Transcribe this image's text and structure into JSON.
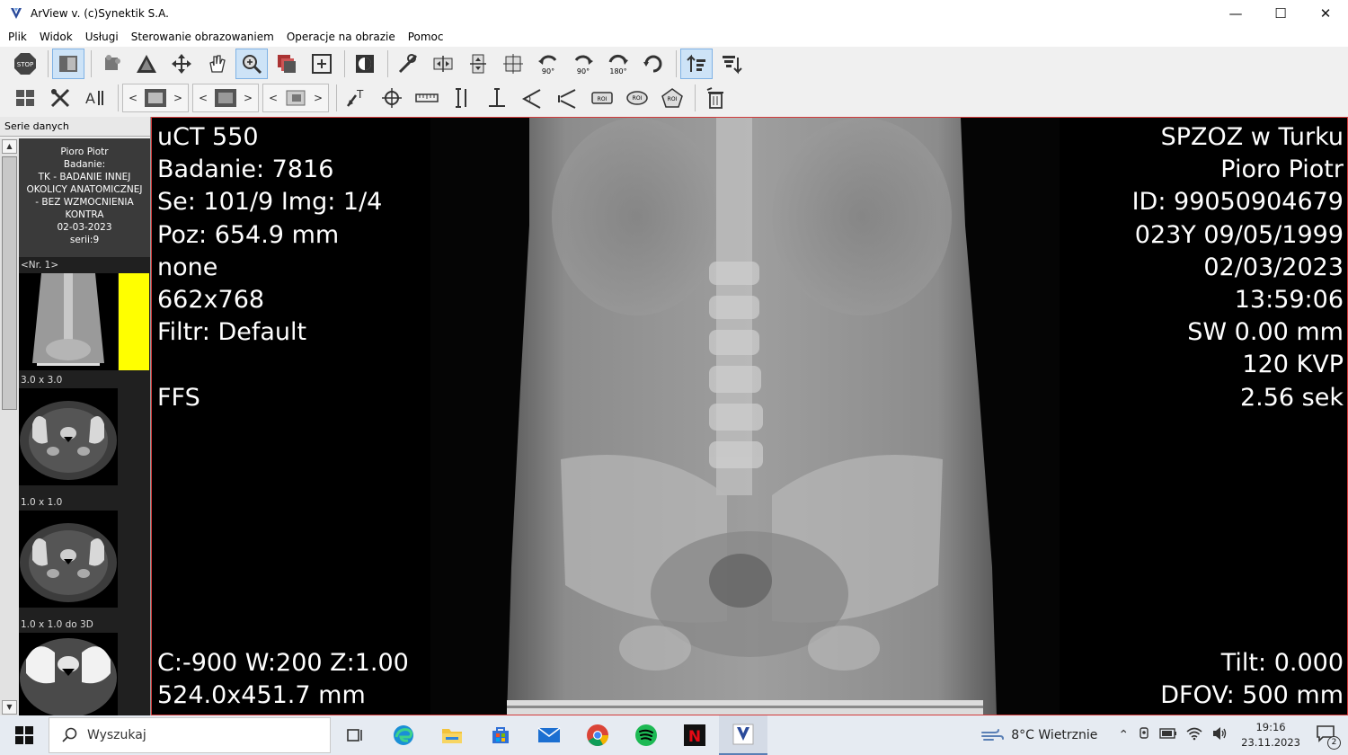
{
  "window": {
    "title": "ArView v. (c)Synektik S.A.",
    "icon": "arview-logo-icon",
    "controls": {
      "minimize": "—",
      "maximize": "☐",
      "close": "✕"
    }
  },
  "menu": [
    "Plik",
    "Widok",
    "Usługi",
    "Sterowanie obrazowaniem",
    "Operacje na obrazie",
    "Pomoc"
  ],
  "toolbar_row1": [
    {
      "name": "stop-icon",
      "label": "STOP"
    },
    {
      "name": "layout-panel-icon",
      "active": true
    },
    {
      "name": "puzzle-icon"
    },
    {
      "name": "triangle-window-icon"
    },
    {
      "name": "move-arrows-icon"
    },
    {
      "name": "hand-pan-icon"
    },
    {
      "name": "zoom-magnifier-icon",
      "active": true
    },
    {
      "name": "image-stack-icon"
    },
    {
      "name": "add-frame-icon"
    },
    {
      "name": "invert-icon"
    },
    {
      "name": "tools-icon"
    },
    {
      "name": "flip-horizontal-icon"
    },
    {
      "name": "flip-vertical-icon"
    },
    {
      "name": "center-crosshair-icon"
    },
    {
      "name": "rotate-left-90-icon",
      "label": "90°"
    },
    {
      "name": "rotate-right-90-icon",
      "label": "90°"
    },
    {
      "name": "rotate-180-icon",
      "label": "180°"
    },
    {
      "name": "reset-rotate-icon"
    },
    {
      "name": "sort-up-icon",
      "active": true
    },
    {
      "name": "filter-down-icon"
    }
  ],
  "toolbar_row2": [
    {
      "name": "grid-layout-icon"
    },
    {
      "name": "settings-tools-icon"
    },
    {
      "name": "text-align-icon"
    }
  ],
  "toolbar_row2_nav": [
    {
      "name": "series-nav-1",
      "prev": "<",
      "next": ">"
    },
    {
      "name": "series-nav-2",
      "prev": "<",
      "next": ">"
    },
    {
      "name": "series-nav-3",
      "prev": "<",
      "next": ">"
    }
  ],
  "toolbar_row2_tools": [
    {
      "name": "text-annotation-icon"
    },
    {
      "name": "crosshair-target-icon"
    },
    {
      "name": "ruler-icon"
    },
    {
      "name": "vertical-measure-icon"
    },
    {
      "name": "perpendicular-icon"
    },
    {
      "name": "angle-icon"
    },
    {
      "name": "cobb-angle-icon"
    },
    {
      "name": "roi-rect-icon",
      "label": "ROI"
    },
    {
      "name": "roi-ellipse-icon",
      "label": "ROI"
    },
    {
      "name": "roi-polygon-icon",
      "label": "ROI"
    },
    {
      "name": "trash-icon"
    }
  ],
  "sidebar": {
    "header": "Serie danych",
    "patient": {
      "name": "Pioro Piotr",
      "study_label": "Badanie:",
      "description": "TK - BADANIE INNEJ OKOLICY ANATOMICZNEJ - BEZ WZMOCNIENIA KONTRA",
      "date": "02-03-2023",
      "series_count": "serii:9"
    },
    "series": [
      {
        "label": "<Nr. 1>",
        "kind": "scout",
        "selected": true
      },
      {
        "label": "3.0 x 3.0",
        "kind": "axial"
      },
      {
        "label": "1.0 x 1.0",
        "kind": "axial"
      },
      {
        "label": "1.0 x 1.0 do 3D",
        "kind": "axial-bright"
      }
    ]
  },
  "overlay": {
    "top_left": [
      "uCT 550",
      "Badanie: 7816",
      "Se: 101/9 Img: 1/4",
      "Poz: 654.9 mm",
      "none",
      "662x768",
      "Filtr: Default",
      "",
      "FFS"
    ],
    "top_right": [
      "SPZOZ w Turku",
      "Pioro Piotr",
      "ID: 99050904679",
      "023Y 09/05/1999",
      "02/03/2023",
      "13:59:06",
      "SW 0.00 mm",
      "120 KVP",
      "2.56 sek"
    ],
    "bottom_left": [
      "C:-900 W:200 Z:1.00",
      "524.0x451.7 mm"
    ],
    "bottom_right": [
      "Tilt: 0.000",
      "DFOV: 500 mm"
    ]
  },
  "taskbar": {
    "search_placeholder": "Wyszukaj",
    "apps": [
      {
        "name": "task-view-icon"
      },
      {
        "name": "edge-browser-icon"
      },
      {
        "name": "file-explorer-icon"
      },
      {
        "name": "store-icon"
      },
      {
        "name": "mail-icon"
      },
      {
        "name": "chrome-icon"
      },
      {
        "name": "spotify-icon"
      },
      {
        "name": "netflix-icon",
        "label": "N"
      },
      {
        "name": "arview-task-icon",
        "running": true
      }
    ],
    "weather": "8°C  Wietrznie",
    "time": "19:16",
    "date": "23.11.2023",
    "notifications": "2"
  },
  "colors": {
    "viewport_border": "#d23a3a",
    "selected_marker": "#ffff00",
    "active_button": "#cde3f7"
  }
}
